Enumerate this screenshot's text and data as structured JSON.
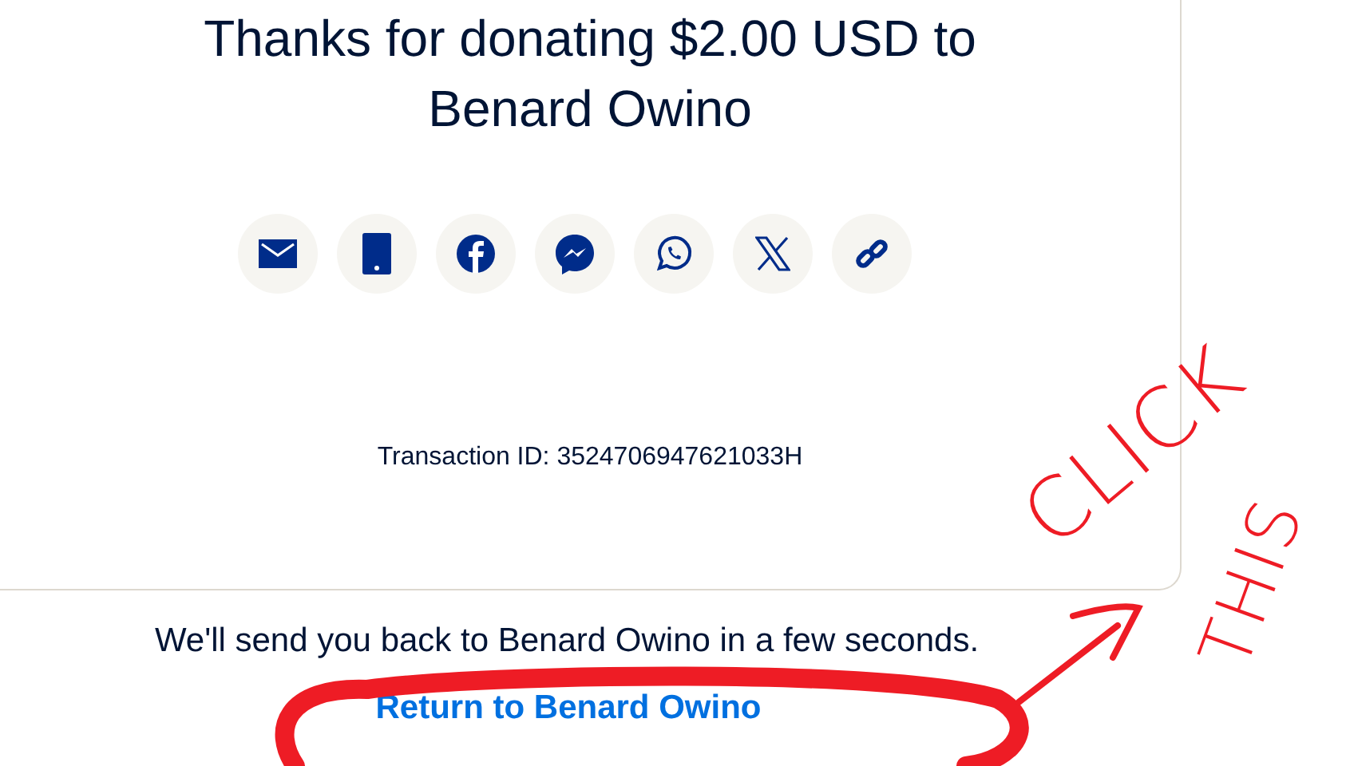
{
  "heading": "Thanks for donating $2.00 USD to Benard Owino",
  "share_buttons": [
    {
      "kind": "email"
    },
    {
      "kind": "sms"
    },
    {
      "kind": "facebook"
    },
    {
      "kind": "messenger"
    },
    {
      "kind": "whatsapp"
    },
    {
      "kind": "x"
    },
    {
      "kind": "link"
    }
  ],
  "transaction_id": "Transaction ID: 3524706947621033H",
  "redirect_message": "We'll send you back to Benard Owino in a few seconds.",
  "return_link": "Return to Benard Owino",
  "annotation": {
    "words": [
      "CLICK",
      "THIS"
    ]
  }
}
